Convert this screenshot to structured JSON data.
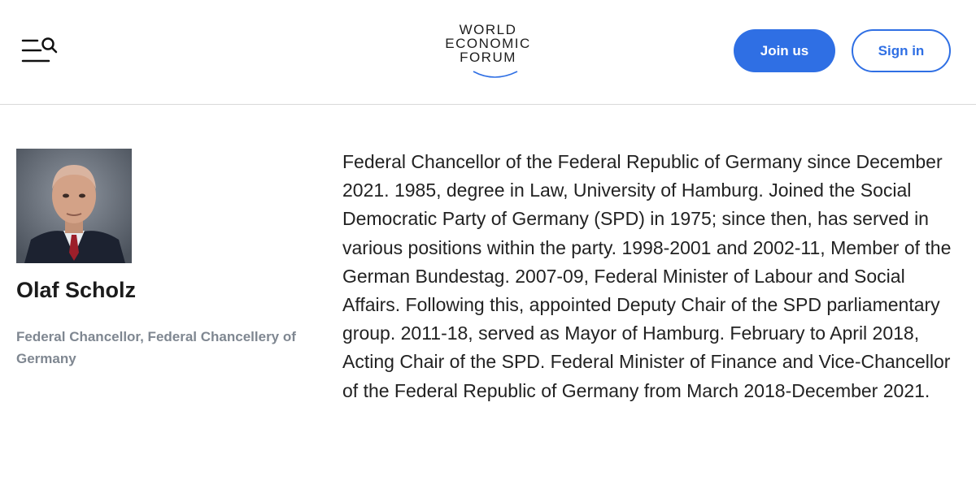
{
  "header": {
    "logo": {
      "line1": "WORLD",
      "line2": "ECONOMIC",
      "line3": "FORUM"
    },
    "join_label": "Join us",
    "signin_label": "Sign in"
  },
  "profile": {
    "name": "Olaf Scholz",
    "role": "Federal Chancellor, Federal Chancellery of Germany",
    "bio": "Federal Chancellor of the Federal Republic of Germany since December 2021. 1985, degree in Law, University of Hamburg. Joined the Social Democratic Party of Germany (SPD) in 1975; since then, has served in various positions within the party. 1998-2001 and 2002-11, Member of the German Bundestag. 2007-09, Federal Minister of Labour and Social Affairs. Following this, appointed Deputy Chair of the SPD parliamentary group. 2011-18, served as Mayor of Hamburg. February to April 2018, Acting Chair of the SPD. Federal Minister of Finance and Vice-Chancellor of the Federal Republic of Germany from March 2018-December 2021."
  },
  "colors": {
    "accent": "#2f6fe4",
    "muted_text": "#7f8791",
    "divider": "#d9d9d9"
  }
}
